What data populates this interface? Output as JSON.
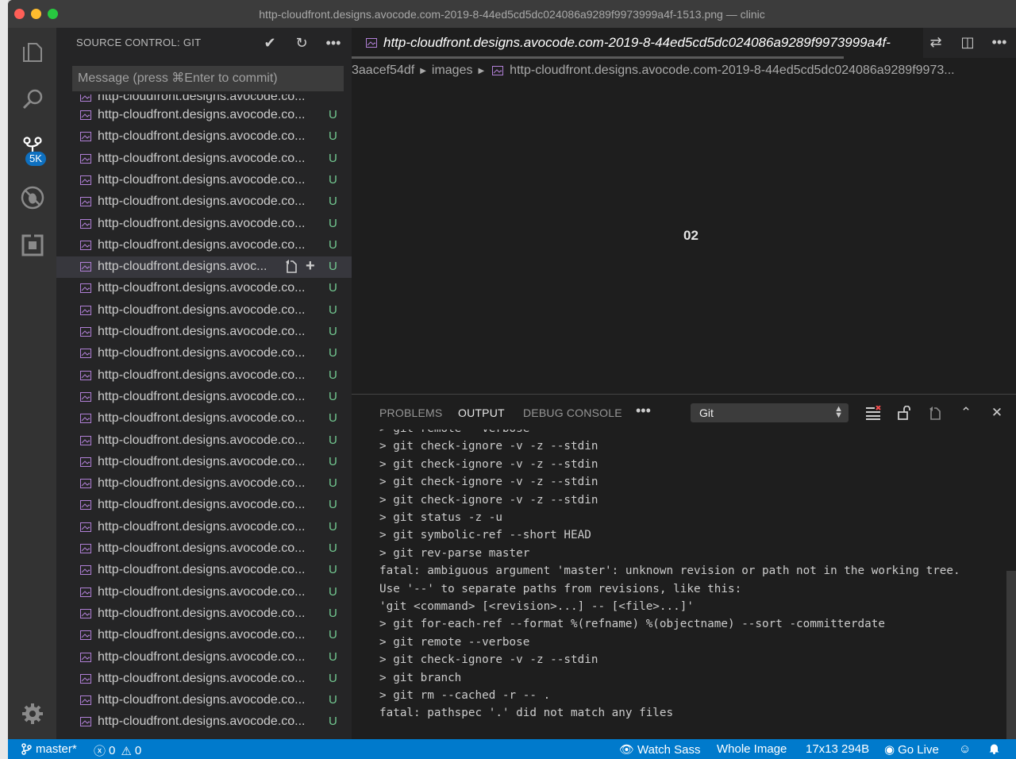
{
  "window": {
    "title": "http-cloudfront.designs.avocode.com-2019-8-44ed5cd5dc024086a9289f9973999a4f-1513.png — clinic"
  },
  "activity": {
    "scm_badge": "5K"
  },
  "sidebar": {
    "title": "SOURCE CONTROL: GIT",
    "commit_placeholder": "Message (press ⌘Enter to commit)",
    "partial_row_label": "http-cloudfront.designs.avocode.co...",
    "file_label": "http-cloudfront.designs.avocode.co...",
    "active_file_label": "http-cloudfront.designs.avoc...",
    "status_letter": "U",
    "files": [
      "http-cloudfront.designs.avocode.co...",
      "http-cloudfront.designs.avocode.co...",
      "http-cloudfront.designs.avocode.co...",
      "http-cloudfront.designs.avocode.co...",
      "http-cloudfront.designs.avocode.co...",
      "http-cloudfront.designs.avocode.co...",
      "http-cloudfront.designs.avocode.co...",
      "http-cloudfront.designs.avoc...",
      "http-cloudfront.designs.avocode.co...",
      "http-cloudfront.designs.avocode.co...",
      "http-cloudfront.designs.avocode.co...",
      "http-cloudfront.designs.avocode.co...",
      "http-cloudfront.designs.avocode.co...",
      "http-cloudfront.designs.avocode.co...",
      "http-cloudfront.designs.avocode.co...",
      "http-cloudfront.designs.avocode.co...",
      "http-cloudfront.designs.avocode.co...",
      "http-cloudfront.designs.avocode.co...",
      "http-cloudfront.designs.avocode.co...",
      "http-cloudfront.designs.avocode.co...",
      "http-cloudfront.designs.avocode.co...",
      "http-cloudfront.designs.avocode.co...",
      "http-cloudfront.designs.avocode.co...",
      "http-cloudfront.designs.avocode.co...",
      "http-cloudfront.designs.avocode.co...",
      "http-cloudfront.designs.avocode.co...",
      "http-cloudfront.designs.avocode.co...",
      "http-cloudfront.designs.avocode.co...",
      "http-cloudfront.designs.avocode.co..."
    ]
  },
  "editor": {
    "tab_label": "http-cloudfront.designs.avocode.com-2019-8-44ed5cd5dc024086a9289f9973999a4f-",
    "breadcrumb": {
      "seg1": "3aacef54df",
      "seg2": "images",
      "seg3": "http-cloudfront.designs.avocode.com-2019-8-44ed5cd5dc024086a9289f9973..."
    },
    "preview_value": "02"
  },
  "panel": {
    "tabs": [
      "PROBLEMS",
      "OUTPUT",
      "DEBUG CONSOLE"
    ],
    "more": "•••",
    "selected_channel": "Git",
    "output_lines": [
      "> git remote --verbose",
      "> git check-ignore -v -z --stdin",
      "> git check-ignore -v -z --stdin",
      "> git check-ignore -v -z --stdin",
      "> git check-ignore -v -z --stdin",
      "> git status -z -u",
      "> git symbolic-ref --short HEAD",
      "> git rev-parse master",
      "fatal: ambiguous argument 'master': unknown revision or path not in the working tree.",
      "Use '--' to separate paths from revisions, like this:",
      "'git <command> [<revision>...] -- [<file>...]'",
      "> git for-each-ref --format %(refname) %(objectname) --sort -committerdate",
      "> git remote --verbose",
      "> git check-ignore -v -z --stdin",
      "> git branch",
      "> git rm --cached -r -- .",
      "fatal: pathspec '.' did not match any files"
    ]
  },
  "statusbar": {
    "branch": "master*",
    "errors": "0",
    "warnings": "0",
    "watch_sass": "Watch Sass",
    "whole_image": "Whole Image",
    "image_size": "17x13 294B",
    "go_live": "Go Live"
  },
  "colors": {
    "accent": "#007acc",
    "untracked": "#73c991",
    "sidebar_bg": "#252526",
    "editor_bg": "#1e1e1e"
  }
}
